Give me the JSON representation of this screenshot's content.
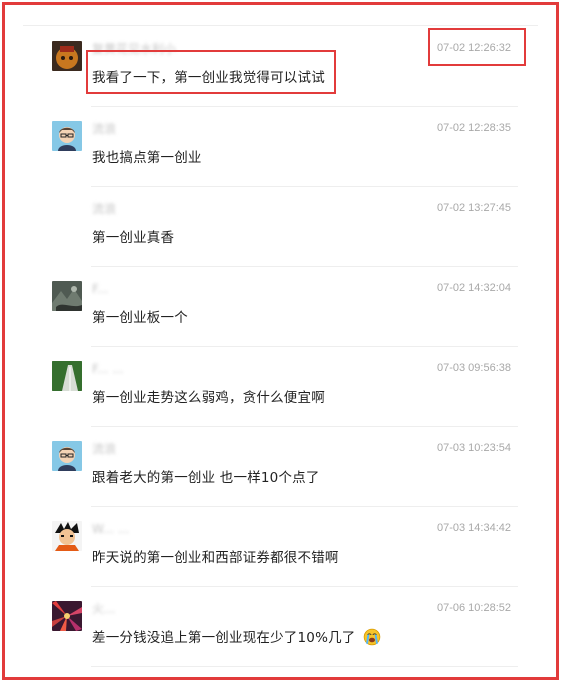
{
  "comments": [
    {
      "username": "复黄花见水利小",
      "time": "07-02 12:26:32",
      "text": "我看了一下，第一创业我觉得可以试试",
      "avatar_icon": "dark-character-avatar-icon"
    },
    {
      "username": "流浪",
      "time": "07-02 12:28:35",
      "text": "我也搞点第一创业",
      "avatar_icon": "cartoon-glasses-avatar-icon"
    },
    {
      "username": "流浪",
      "time": "07-02 13:27:45",
      "text": "第一创业真香",
      "avatar_icon": ""
    },
    {
      "username": "F...",
      "time": "07-02 14:32:04",
      "text": "第一创业板一个",
      "avatar_icon": "landscape-avatar-icon"
    },
    {
      "username": "F... ...",
      "time": "07-03 09:56:38",
      "text": "第一创业走势这么弱鸡，贪什么便宜啊",
      "avatar_icon": "road-avatar-icon"
    },
    {
      "username": "流浪",
      "time": "07-03 10:23:54",
      "text": "跟着老大的第一创业 也一样10个点了",
      "avatar_icon": "cartoon-glasses-avatar-icon"
    },
    {
      "username": "W... ...",
      "time": "07-03 14:34:42",
      "text": "昨天说的第一创业和西部证券都很不错啊",
      "avatar_icon": "anime-character-avatar-icon"
    },
    {
      "username": "火...",
      "time": "07-06 10:28:52",
      "text": "差一分钱没追上第一创业现在少了10%几了",
      "avatar_icon": "red-rays-avatar-icon",
      "emoji_icon": "crying-face-emoji-icon"
    }
  ],
  "colors": {
    "highlight_border": "#e23b3b",
    "timestamp": "#a8a8a8",
    "body_text": "#222222",
    "divider": "#eeeeee"
  }
}
